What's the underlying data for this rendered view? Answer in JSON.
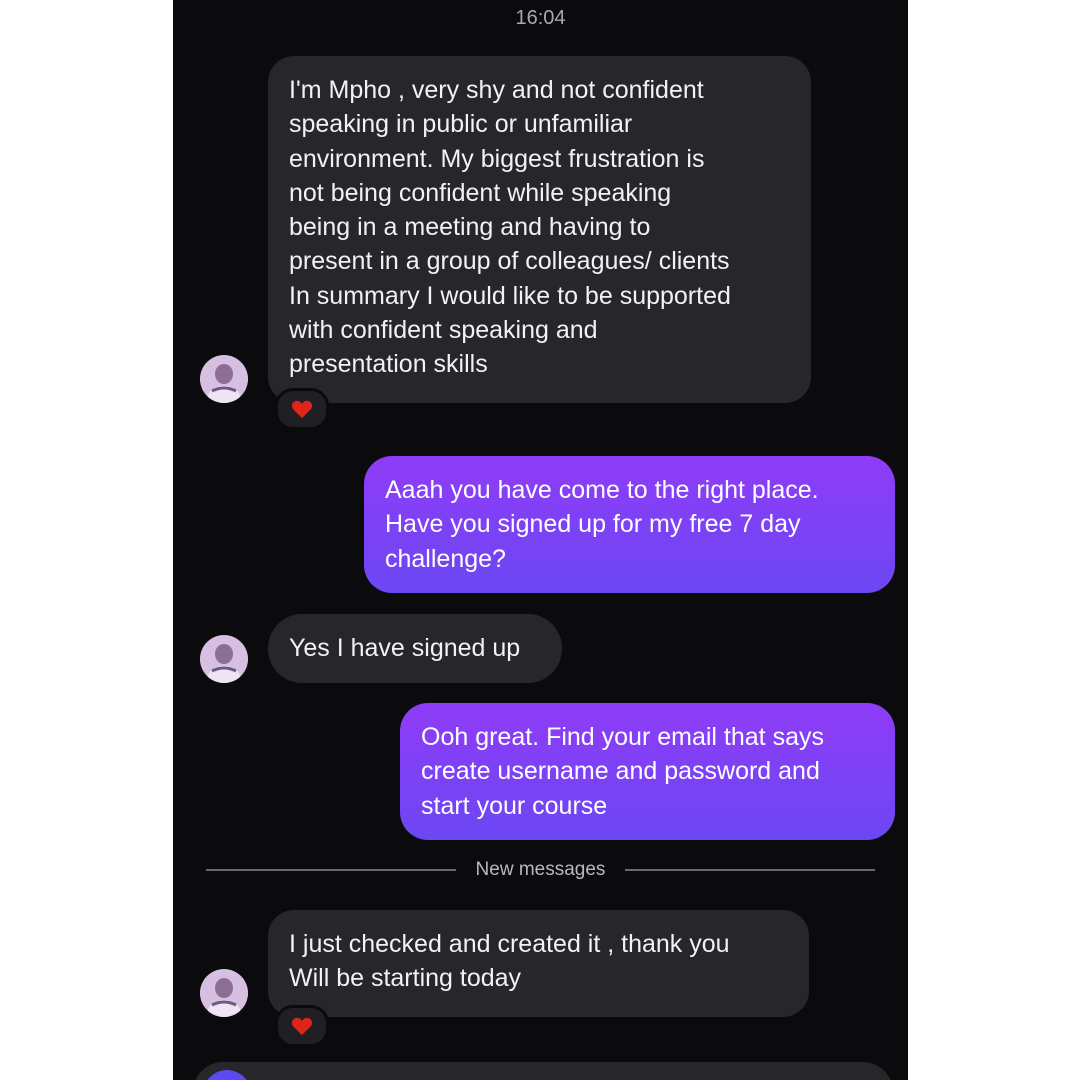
{
  "header": {
    "time": "16:04"
  },
  "messages": [
    {
      "direction": "incoming",
      "text": "I'm Mpho , very shy and not confident\nspeaking in public or unfamiliar\nenvironment. My biggest frustration is\nnot being confident while speaking\nbeing in a meeting and having to\npresent in a group of colleagues/ clients\nIn summary I would like to be supported\nwith confident speaking and\npresentation skills",
      "reaction": "heart-icon"
    },
    {
      "direction": "outgoing",
      "text": "Aaah you have come to the right place.\nHave you signed up for my free 7 day\nchallenge?"
    },
    {
      "direction": "incoming",
      "text": "Yes I have signed up"
    },
    {
      "direction": "outgoing",
      "text": "Ooh great. Find your email that says\ncreate username and password and\nstart your course"
    },
    {
      "direction": "incoming",
      "text": "I just checked and created it , thank you\nWill be starting today",
      "reaction": "heart-icon"
    }
  ],
  "divider": {
    "label": "New messages"
  },
  "colors": {
    "background": "#0b0b0e",
    "incoming_bubble": "#26262b",
    "outgoing_gradient_top": "#8f3cf7",
    "outgoing_gradient_bottom": "#6c47f3",
    "reaction_heart": "#e0241b"
  }
}
